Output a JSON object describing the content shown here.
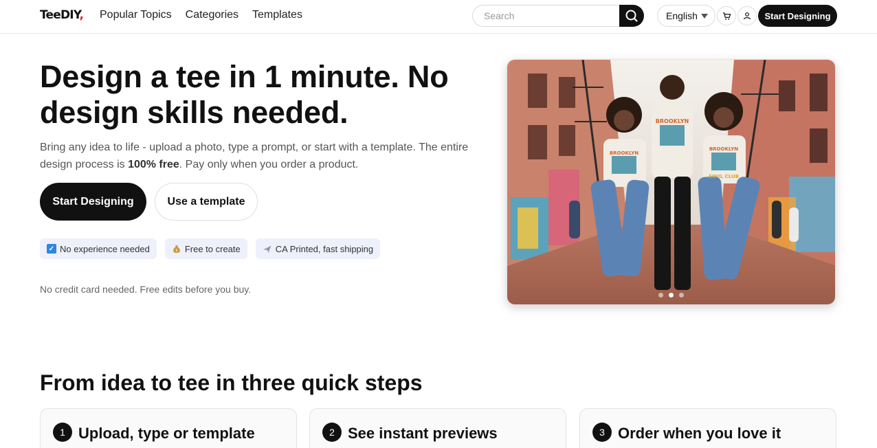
{
  "header": {
    "logo_main": "TeeDIY",
    "logo_accent": ",",
    "nav": [
      "Popular Topics",
      "Categories",
      "Templates"
    ],
    "search_placeholder": "Search",
    "language": "English",
    "cta": "Start Designing",
    "icons": {
      "search": "search-icon",
      "cart": "cart-icon",
      "user": "user-icon",
      "caret": "chevron-down-icon"
    }
  },
  "hero": {
    "title": "Design a tee in 1 minute. No design skills needed.",
    "subtitle_before": "Bring any idea to life - upload a photo, type a prompt, or start with a template. The entire design process is ",
    "subtitle_bold": "100% free",
    "subtitle_after": ". Pay only when you order a product.",
    "primary_button": "Start Designing",
    "secondary_button": "Use a template",
    "pills": [
      {
        "icon": "checkbox-icon",
        "label": "No experience needed"
      },
      {
        "icon": "money-bag-icon",
        "label": "Free to create"
      },
      {
        "icon": "airplane-icon",
        "label": "CA Printed, fast shipping"
      }
    ],
    "note": "No credit card needed. Free edits before you buy.",
    "carousel": {
      "slides": 3,
      "active": 1
    },
    "shirt_print_top": "BROOKLYN",
    "shirt_print_bottom": "SOUL CLUB"
  },
  "steps": {
    "title": "From idea to tee in three quick steps",
    "items": [
      {
        "number": "1",
        "title": "Upload, type or template"
      },
      {
        "number": "2",
        "title": "See instant previews"
      },
      {
        "number": "3",
        "title": "Order when you love it"
      }
    ]
  },
  "colors": {
    "brand_dark": "#111111",
    "accent_red": "#e0242b",
    "pill_bg": "#eef1fb"
  }
}
